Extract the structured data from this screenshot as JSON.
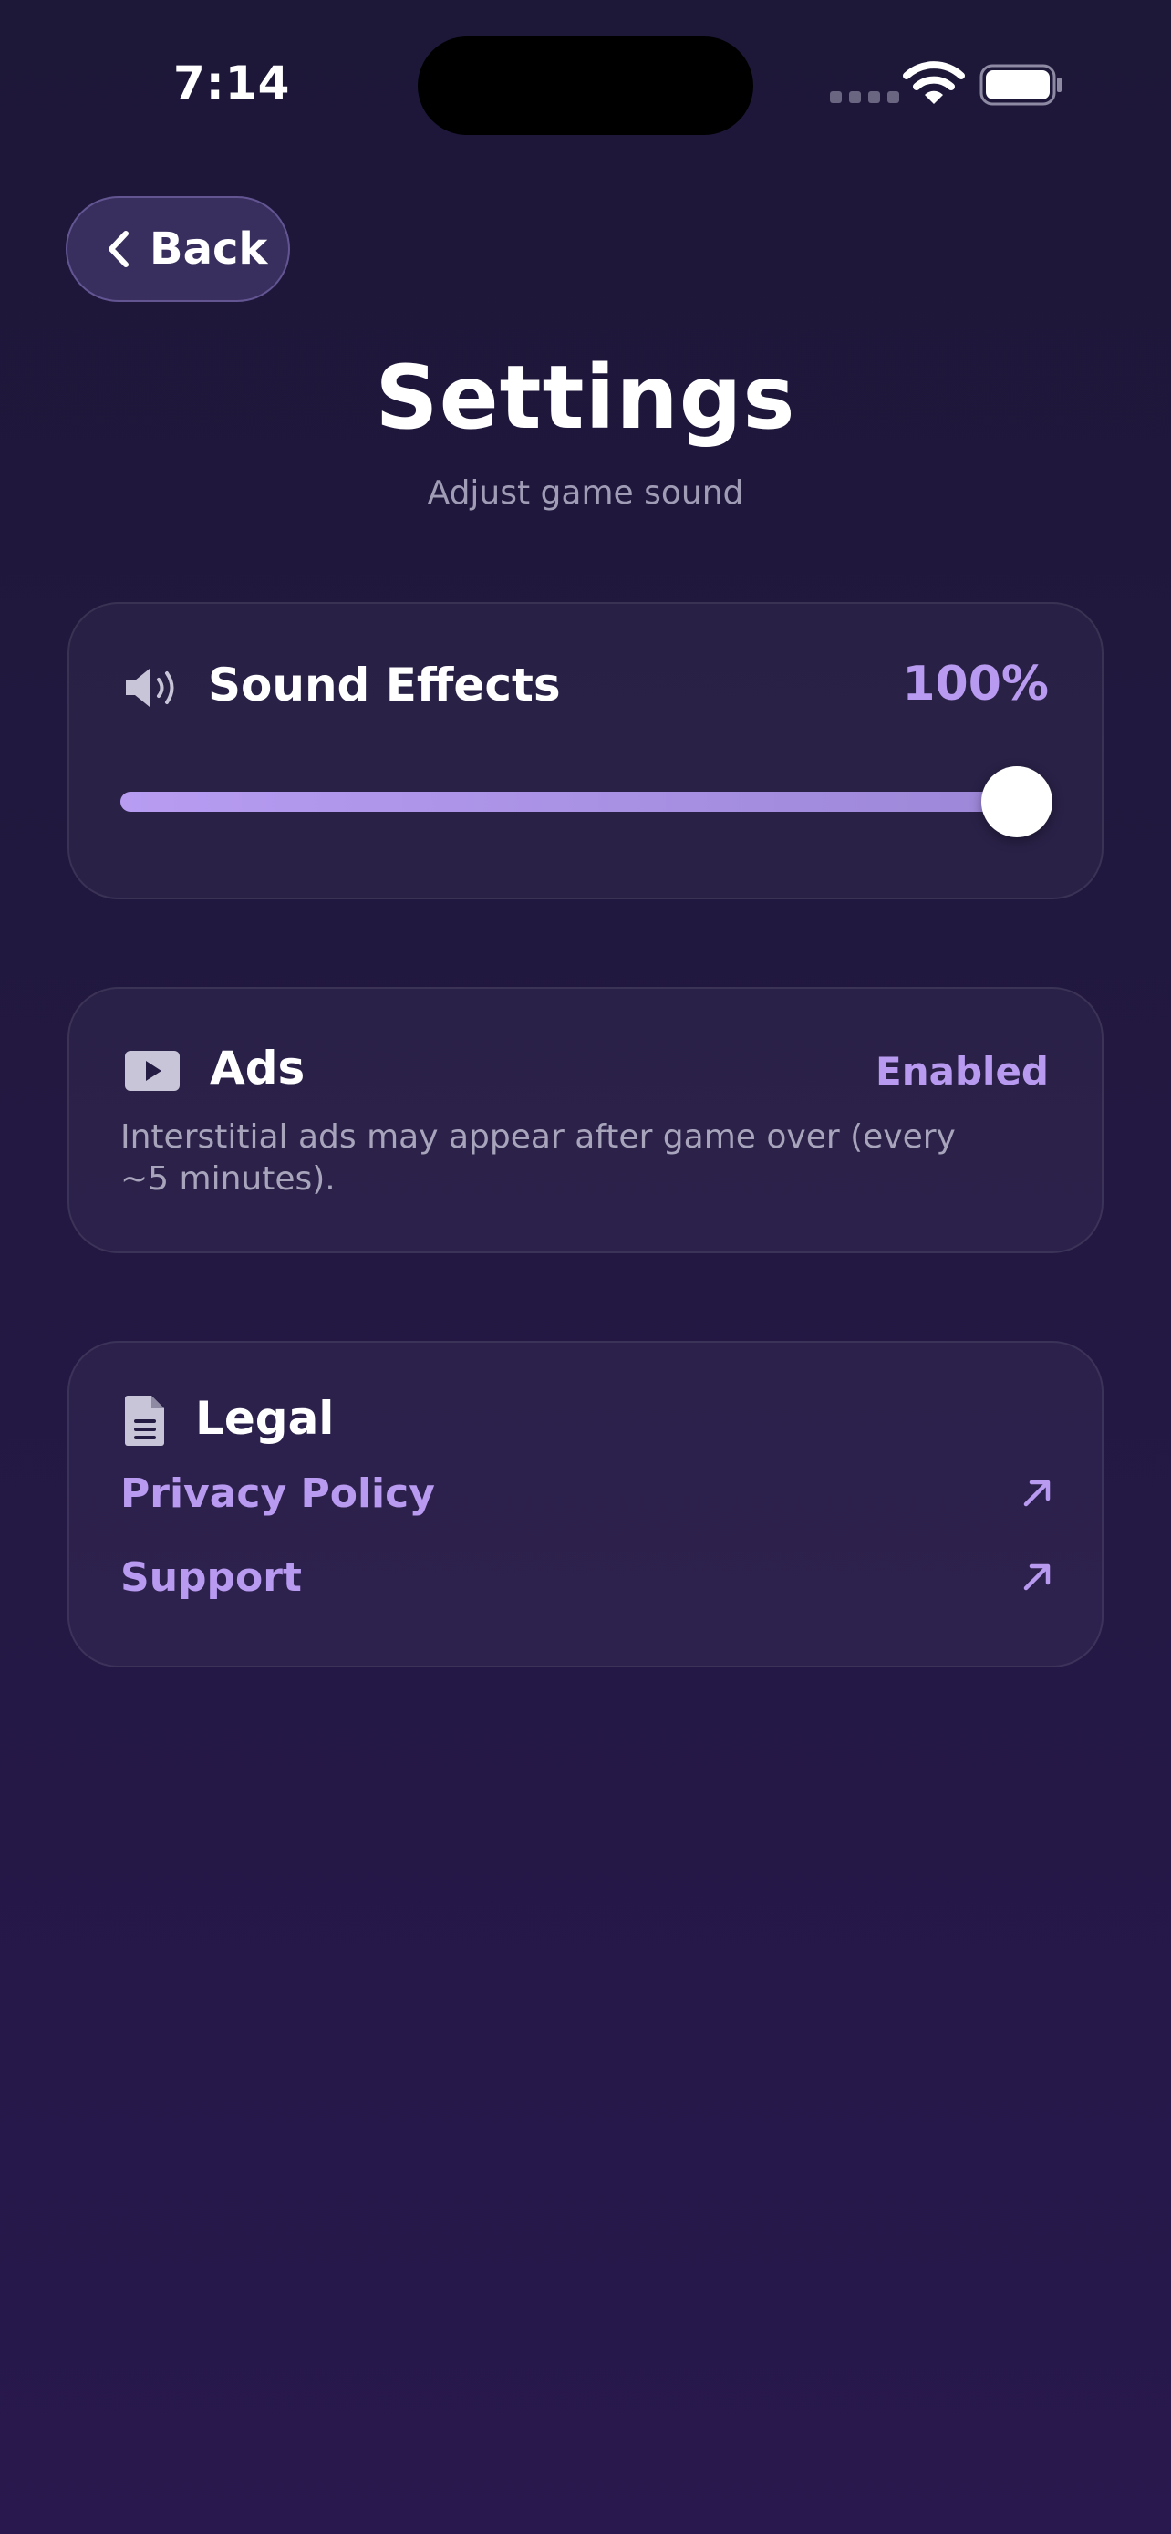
{
  "status_bar": {
    "time": "7:14",
    "icons": [
      "cellular-dots-icon",
      "wifi-icon",
      "battery-icon"
    ]
  },
  "nav": {
    "back_label": "Back",
    "back_icon": "chevron-left-icon"
  },
  "header": {
    "title": "Settings",
    "subtitle": "Adjust game sound"
  },
  "sound": {
    "icon": "speaker-icon",
    "label": "Sound Effects",
    "value_text": "100%",
    "volume_percent": 100
  },
  "ads": {
    "icon": "play-icon",
    "label": "Ads",
    "status": "Enabled",
    "description": "Interstitial ads may appear after game over (every ~5 minutes)."
  },
  "legal": {
    "icon": "document-icon",
    "label": "Legal",
    "links": [
      {
        "label": "Privacy Policy",
        "icon": "external-arrow-icon"
      },
      {
        "label": "Support",
        "icon": "external-arrow-icon"
      }
    ]
  },
  "colors": {
    "accent": "#b89af0",
    "background": "#1d1738",
    "card_border": "#3a3358",
    "secondary_text": "#a8a4bc"
  }
}
